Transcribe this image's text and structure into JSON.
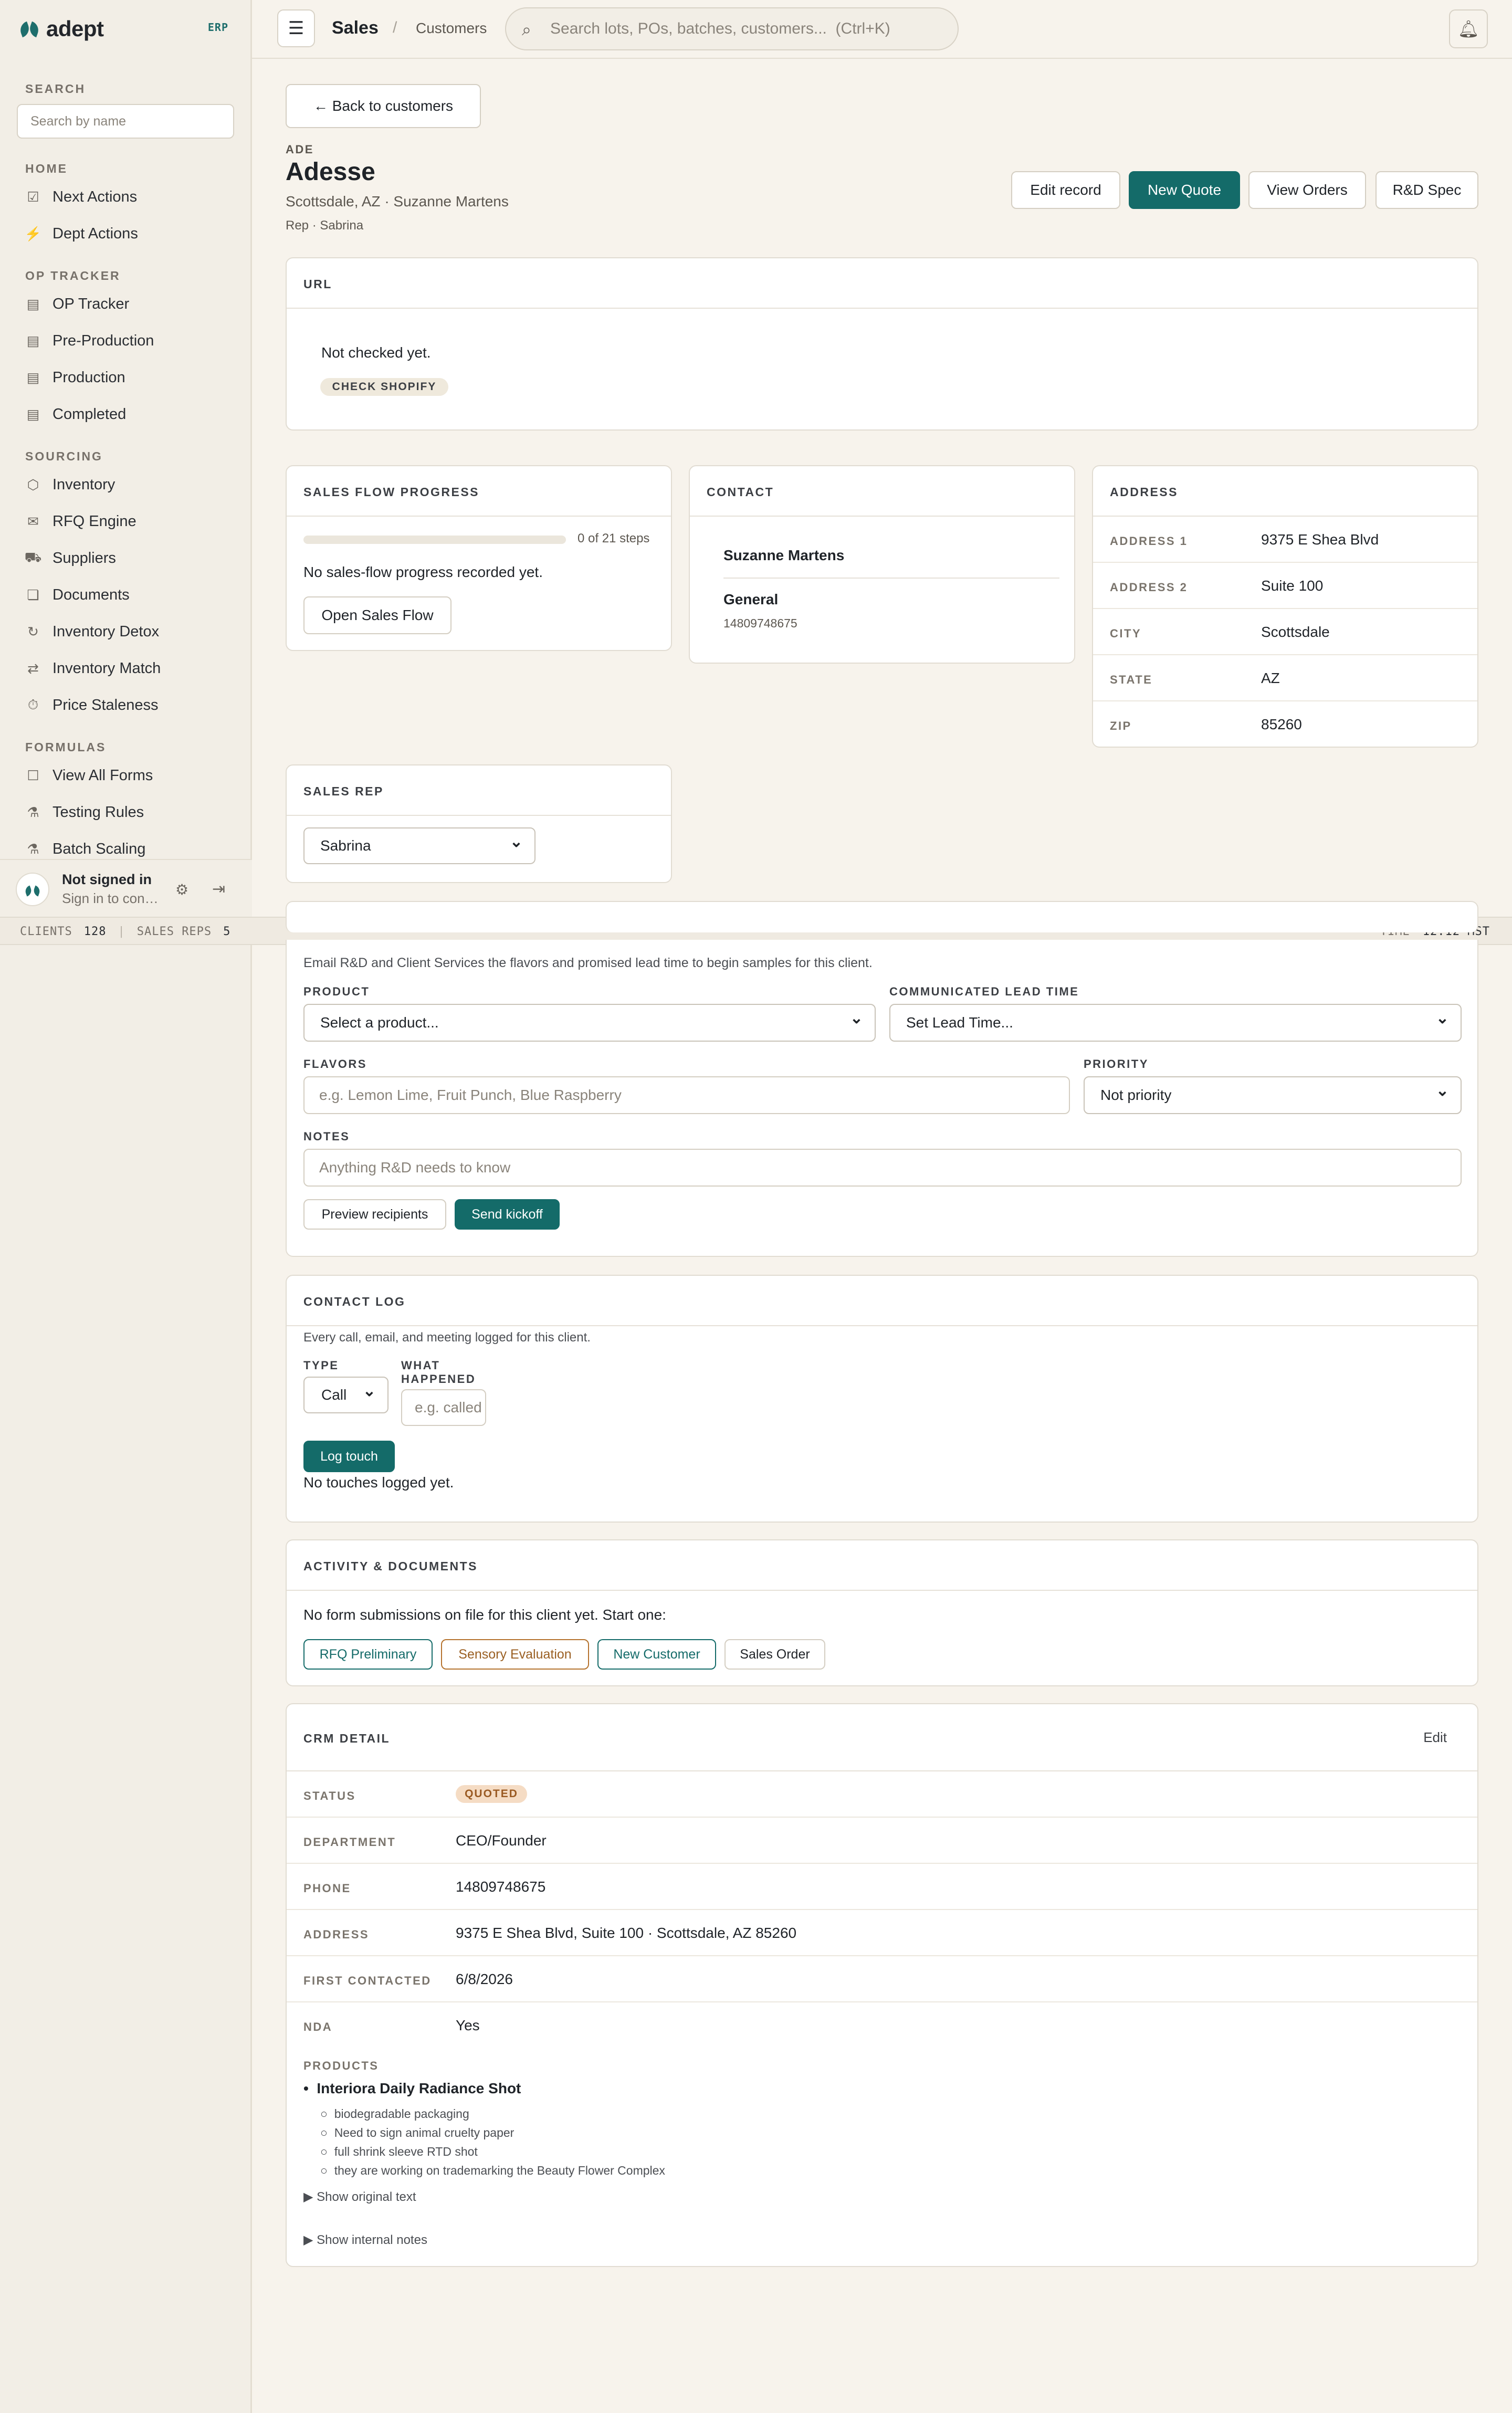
{
  "sidebar": {
    "brand": "adept",
    "badge": "ERP",
    "search_label": "SEARCH",
    "search_placeholder": "Search by name",
    "sections": [
      {
        "title": "HOME",
        "items": [
          {
            "label": "Next Actions",
            "icon": "check-square-icon"
          },
          {
            "label": "Dept Actions",
            "icon": "lightning-icon"
          }
        ]
      },
      {
        "title": "OP TRACKER",
        "items": [
          {
            "label": "OP Tracker",
            "icon": "list-icon"
          },
          {
            "label": "Pre-Production",
            "icon": "list-icon"
          },
          {
            "label": "Production",
            "icon": "list-icon"
          },
          {
            "label": "Completed",
            "icon": "list-icon"
          }
        ]
      },
      {
        "title": "SOURCING",
        "items": [
          {
            "label": "Inventory",
            "icon": "box-icon"
          },
          {
            "label": "RFQ Engine",
            "icon": "mail-icon"
          },
          {
            "label": "Suppliers",
            "icon": "truck-icon"
          },
          {
            "label": "Documents",
            "icon": "document-icon"
          },
          {
            "label": "Inventory Detox",
            "icon": "refresh-icon"
          },
          {
            "label": "Inventory Match",
            "icon": "arrows-icon"
          },
          {
            "label": "Price Staleness",
            "icon": "clock-icon"
          }
        ]
      },
      {
        "title": "FORMULAS",
        "items": [
          {
            "label": "View All Forms",
            "icon": "form-icon"
          },
          {
            "label": "Testing Rules",
            "icon": "beaker-icon"
          },
          {
            "label": "Batch Scaling",
            "icon": "beaker-icon"
          }
        ]
      }
    ],
    "user": {
      "name": "Not signed in",
      "sub": "Sign in to continue"
    }
  },
  "statusbar": {
    "clients_label": "CLIENTS",
    "clients": "128",
    "reps_label": "SALES REPS",
    "reps": "5",
    "time_label": "TIME",
    "time": "12:12 MST"
  },
  "topbar": {
    "crumb_section": "Sales",
    "crumb_page": "Customers",
    "search_placeholder": "Search lots, POs, batches, customers...  (Ctrl+K)"
  },
  "header": {
    "back": "← Back to customers",
    "code": "ADE",
    "name": "Adesse",
    "subtitle": "Scottsdale, AZ · Suzanne Martens",
    "rep": "Rep · Sabrina",
    "actions": {
      "edit": "Edit record",
      "quote": "New Quote",
      "orders": "View Orders",
      "spec": "R&D Spec"
    }
  },
  "url_card": {
    "title": "URL",
    "status": "Not checked yet.",
    "check": "CHECK SHOPIFY"
  },
  "sales_flow": {
    "title": "SALES FLOW PROGRESS",
    "progress": 0,
    "steps_text": "0 of 21 steps",
    "empty": "No sales-flow progress recorded yet.",
    "button": "Open Sales Flow"
  },
  "contact": {
    "title": "CONTACT",
    "name": "Suzanne Martens",
    "group": "General",
    "phone": "14809748675"
  },
  "address": {
    "title": "ADDRESS",
    "rows": [
      {
        "k": "ADDRESS 1",
        "v": "9375 E Shea Blvd"
      },
      {
        "k": "ADDRESS 2",
        "v": "Suite 100"
      },
      {
        "k": "CITY",
        "v": "Scottsdale"
      },
      {
        "k": "STATE",
        "v": "AZ"
      },
      {
        "k": "ZIP",
        "v": "85260"
      }
    ]
  },
  "sales_rep": {
    "title": "SALES REP",
    "value": "Sabrina"
  },
  "kickoff": {
    "desc": "Email R&D and Client Services the flavors and promised lead time to begin samples for this client.",
    "product_label": "PRODUCT",
    "product_value": "Select a product...",
    "lead_label": "COMMUNICATED LEAD TIME",
    "lead_value": "Set Lead Time...",
    "flavors_label": "FLAVORS",
    "flavors_placeholder": "e.g. Lemon Lime, Fruit Punch, Blue Raspberry",
    "priority_label": "PRIORITY",
    "priority_value": "Not priority",
    "notes_label": "NOTES",
    "notes_placeholder": "Anything R&D needs to know",
    "preview": "Preview recipients",
    "send": "Send kickoff"
  },
  "contact_log": {
    "title": "CONTACT LOG",
    "desc": "Every call, email, and meeting logged for this client.",
    "type_label": "TYPE",
    "type_value": "Call",
    "what_label_1": "WHAT",
    "what_label_2": "HAPPENED",
    "what_placeholder": "e.g. called",
    "log": "Log touch",
    "empty": "No touches logged yet."
  },
  "activity": {
    "title": "ACTIVITY & DOCUMENTS",
    "empty": "No form submissions on file for this client yet. Start one:",
    "forms": [
      "RFQ Preliminary",
      "Sensory Evaluation",
      "New Customer",
      "Sales Order"
    ]
  },
  "crm": {
    "title": "CRM DETAIL",
    "edit": "Edit",
    "status_label": "STATUS",
    "status": "QUOTED",
    "rows": [
      {
        "k": "DEPARTMENT",
        "v": "CEO/Founder"
      },
      {
        "k": "PHONE",
        "v": "14809748675"
      },
      {
        "k": "ADDRESS",
        "v": "9375 E Shea Blvd, Suite 100 · Scottsdale, AZ 85260"
      },
      {
        "k": "FIRST CONTACTED",
        "v": "6/8/2026"
      },
      {
        "k": "NDA",
        "v": "Yes"
      }
    ],
    "products_label": "PRODUCTS",
    "product_name": "Interiora Daily Radiance Shot",
    "product_notes": [
      "biodegradable packaging",
      "Need to sign animal cruelty paper",
      "full shrink sleeve RTD shot",
      "they are working on trademarking the Beauty Flower Complex"
    ],
    "show_original": "Show original text",
    "show_internal": "Show internal notes"
  },
  "colors": {
    "accent": "#146b69",
    "bg": "#f7f3ec",
    "sidebar": "#f2eee6"
  }
}
